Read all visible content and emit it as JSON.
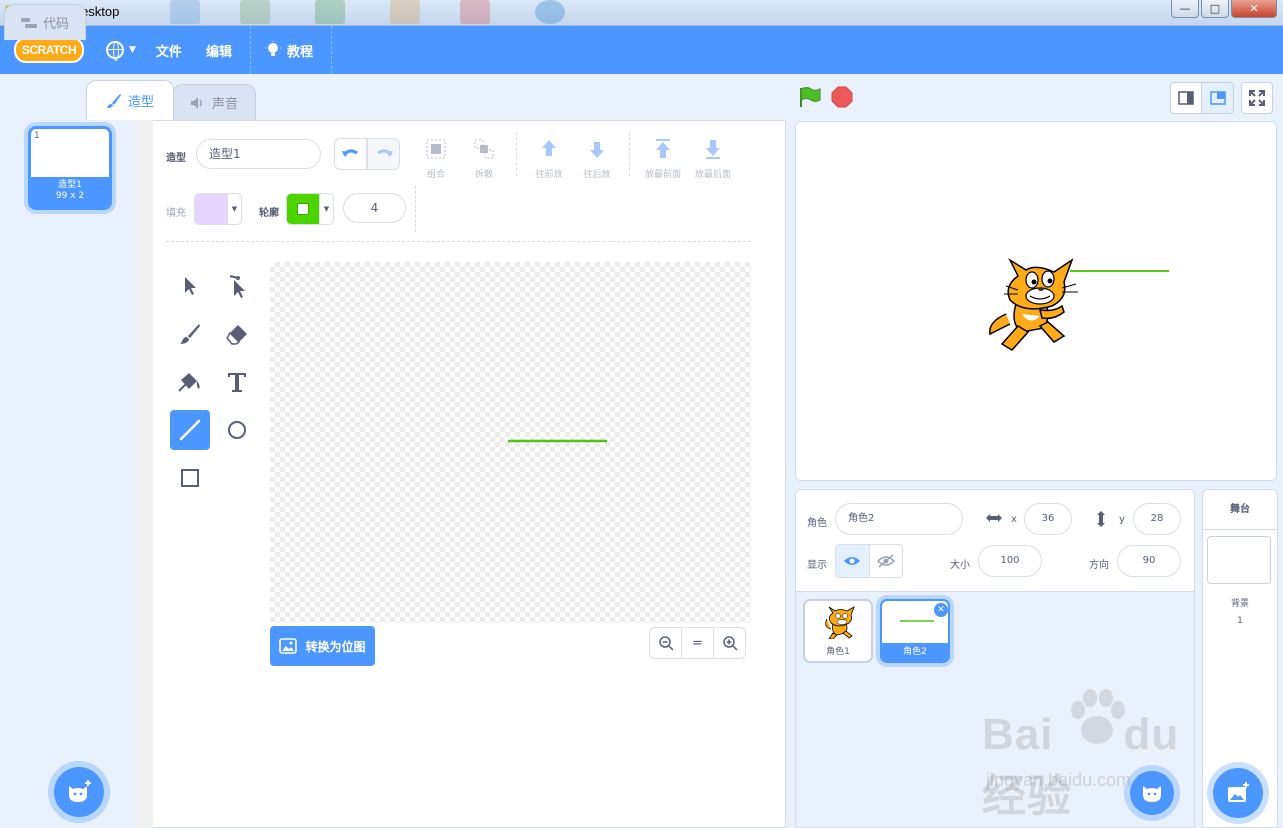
{
  "window": {
    "title": "Scratch Desktop",
    "minimize": "—",
    "maximize": "□",
    "close": "✕"
  },
  "menubar": {
    "logo": "SCRATCH",
    "file": "文件",
    "edit": "编辑",
    "tutorials": "教程"
  },
  "tabs": {
    "code": "代码",
    "costumes": "造型",
    "sounds": "声音"
  },
  "costume_list": {
    "items": [
      {
        "number": "1",
        "name": "造型1",
        "size": "99 x 2"
      }
    ]
  },
  "paint": {
    "costume_label": "造型",
    "costume_name": "造型1",
    "actions": {
      "group": "组合",
      "ungroup": "拆散",
      "forward": "往前放",
      "backward": "往后放",
      "front": "放最前面",
      "back": "放最后面"
    },
    "fill_label": "填充",
    "outline_label": "轮廓",
    "outline_width": "4",
    "convert_button": "转换为位图",
    "zoom": {
      "out": "−",
      "reset": "=",
      "in": "+"
    }
  },
  "colors": {
    "accent": "#4c97ff",
    "fill": "#e5d5ff",
    "outline": "#4cd400",
    "line": "#55c418",
    "cat": "#ffab19"
  },
  "sprite_info": {
    "sprite_label": "角色",
    "sprite_name": "角色2",
    "x_label": "x",
    "x_value": "36",
    "y_label": "y",
    "y_value": "28",
    "show_label": "显示",
    "size_label": "大小",
    "size_value": "100",
    "direction_label": "方向",
    "direction_value": "90"
  },
  "sprites": [
    {
      "name": "角色1"
    },
    {
      "name": "角色2"
    }
  ],
  "stage_target": {
    "header": "舞台",
    "backdrop_label": "背景",
    "backdrop_count": "1"
  },
  "watermark": {
    "brand": "Bai",
    "du": "du经验",
    "url": "jingyan.baidu.com"
  }
}
